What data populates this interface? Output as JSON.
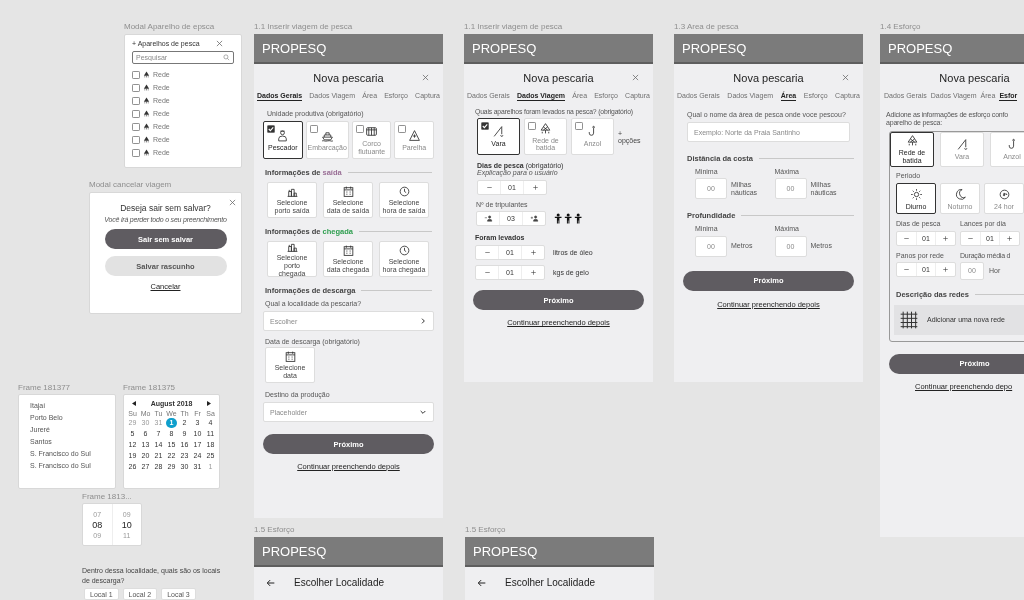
{
  "modal_gear_picker": {
    "frame_label": "Modal Aparelho de epsca",
    "title": "+ Aparelhos de pesca",
    "search": {
      "placeholder": "Pesquisar"
    },
    "items": [
      {
        "label": "Rede",
        "checked": false
      },
      {
        "label": "Rede",
        "checked": false
      },
      {
        "label": "Rede",
        "checked": false
      },
      {
        "label": "Rede",
        "checked": false
      },
      {
        "label": "Rede",
        "checked": false
      },
      {
        "label": "Rede",
        "checked": false
      },
      {
        "label": "Rede",
        "checked": false
      }
    ]
  },
  "modal_cancel": {
    "frame_label": "Modal cancelar viagem",
    "title": "Deseja sair sem salvar?",
    "subtitle": "Você irá perder todo o seu preenchimento",
    "buttons": [
      {
        "label": "Sair sem salvar",
        "kind": "primary"
      },
      {
        "label": "Salvar rascunho",
        "kind": "secondary"
      },
      {
        "label": "Cancelar",
        "kind": "link"
      }
    ]
  },
  "locality_list": {
    "frame_label": "Frame 181377",
    "items": [
      "Itajaí",
      "Porto Belo",
      "Jureré",
      "Santos",
      "S. Francisco do Sul",
      "S. Francisco do Sul"
    ]
  },
  "calendar": {
    "frame_label": "Frame 181375",
    "month": "August 2018",
    "weekdays": [
      "Su",
      "Mo",
      "Tu",
      "We",
      "Th",
      "Fr",
      "Sa"
    ],
    "days": [
      {
        "text": "29",
        "muted": true,
        "selected": false
      },
      {
        "text": "30",
        "muted": true,
        "selected": false
      },
      {
        "text": "31",
        "muted": true,
        "selected": false
      },
      {
        "text": "1",
        "muted": false,
        "selected": true
      },
      {
        "text": "2",
        "muted": false,
        "selected": false
      },
      {
        "text": "3",
        "muted": false,
        "selected": false
      },
      {
        "text": "4",
        "muted": false,
        "selected": false
      },
      {
        "text": "5",
        "muted": false,
        "selected": false
      },
      {
        "text": "6",
        "muted": false,
        "selected": false
      },
      {
        "text": "7",
        "muted": false,
        "selected": false
      },
      {
        "text": "8",
        "muted": false,
        "selected": false
      },
      {
        "text": "9",
        "muted": false,
        "selected": false
      },
      {
        "text": "10",
        "muted": false,
        "selected": false
      },
      {
        "text": "11",
        "muted": false,
        "selected": false
      },
      {
        "text": "12",
        "muted": false,
        "selected": false
      },
      {
        "text": "13",
        "muted": false,
        "selected": false
      },
      {
        "text": "14",
        "muted": false,
        "selected": false
      },
      {
        "text": "15",
        "muted": false,
        "selected": false
      },
      {
        "text": "16",
        "muted": false,
        "selected": false
      },
      {
        "text": "17",
        "muted": false,
        "selected": false
      },
      {
        "text": "18",
        "muted": false,
        "selected": false
      },
      {
        "text": "19",
        "muted": false,
        "selected": false
      },
      {
        "text": "20",
        "muted": false,
        "selected": false
      },
      {
        "text": "21",
        "muted": false,
        "selected": false
      },
      {
        "text": "22",
        "muted": false,
        "selected": false
      },
      {
        "text": "23",
        "muted": false,
        "selected": false
      },
      {
        "text": "24",
        "muted": false,
        "selected": false
      },
      {
        "text": "25",
        "muted": false,
        "selected": false
      },
      {
        "text": "26",
        "muted": false,
        "selected": false
      },
      {
        "text": "27",
        "muted": false,
        "selected": false
      },
      {
        "text": "28",
        "muted": false,
        "selected": false
      },
      {
        "text": "29",
        "muted": false,
        "selected": false
      },
      {
        "text": "30",
        "muted": false,
        "selected": false
      },
      {
        "text": "31",
        "muted": false,
        "selected": false
      },
      {
        "text": "1",
        "muted": true,
        "selected": false
      }
    ]
  },
  "time_picker": {
    "frame_label": "Frame 1813...",
    "columns": [
      {
        "above": "07",
        "value": "08",
        "below": "09"
      },
      {
        "above": "09",
        "value": "10",
        "below": "11"
      }
    ]
  },
  "unload_places": {
    "question": "Dentro dessa localidade, quais são os locais de descarga?",
    "options": [
      "Local 1",
      "Local 2",
      "Local 3"
    ]
  },
  "screen_general": {
    "frame_label": "1.1 Inserir viagem de pesca",
    "app_title": "PROPESQ",
    "heading": "Nova pescaria",
    "tabs": [
      {
        "label": "Dados Gerais",
        "selected": true
      },
      {
        "label": "Dados Viagem",
        "selected": false
      },
      {
        "label": "Área",
        "selected": false
      },
      {
        "label": "Esforço",
        "selected": false
      },
      {
        "label": "Captura",
        "selected": false
      }
    ],
    "unit_label": "Unidade produtiva (obrigatório)",
    "units": [
      {
        "label": "Pescador",
        "checked": true
      },
      {
        "label": "Embarcação",
        "checked": false
      },
      {
        "label": "Corco flutuante",
        "checked": false
      },
      {
        "label": "Parelha",
        "checked": false
      }
    ],
    "info_sections": [
      {
        "title": "Informações de",
        "highlight": "saída",
        "color": "#9a6f96",
        "tiles": [
          "Selecione porto saída",
          "Selecione data de saída",
          "Selecione hora de saída"
        ]
      },
      {
        "title": "Informações de",
        "highlight": "chegada",
        "color": "#2e9e4f",
        "tiles": [
          "Selecione porto chegada",
          "Selecione data chegada",
          "Selecione hora chegada"
        ]
      }
    ],
    "unload": {
      "title": "Informações de descarga",
      "place_label": "Qual a localidade da pescaria?",
      "place_field": {
        "placeholder": "Escolher"
      },
      "date_label": "Data de descarga (obrigatório)",
      "date_button": "Selecione data",
      "dest_label": "Destino da produção",
      "dest_select": {
        "placeholder": "Placeholder"
      }
    },
    "next": "Próximo",
    "later": "Continuar preenchendo depois"
  },
  "screen_trip": {
    "frame_label": "1.1 Inserir viagem de pesca",
    "app_title": "PROPESQ",
    "heading": "Nova pescaria",
    "tabs": [
      {
        "label": "Dados Gerais",
        "selected": false
      },
      {
        "label": "Dados Viagem",
        "selected": true
      },
      {
        "label": "Área",
        "selected": false
      },
      {
        "label": "Esforço",
        "selected": false
      },
      {
        "label": "Captura",
        "selected": false
      }
    ],
    "gear_label": "Quais aparelhos foram levados na pesca? (obrigatório)",
    "gears": [
      {
        "label": "Vara",
        "checked": true
      },
      {
        "label": "Rede de batida",
        "checked": false
      },
      {
        "label": "Anzol",
        "checked": false
      }
    ],
    "more": "+ opções",
    "days": {
      "label": "**Dias de pesca** (obrigatório)",
      "help": "Explicação para o usuário",
      "value": "01"
    },
    "crew": {
      "label": "Nº de tripulantes",
      "value": "03"
    },
    "taken_label": "Foram levados",
    "taken": [
      {
        "value": "01",
        "unit": "litros de óleo"
      },
      {
        "value": "01",
        "unit": "kgs de gelo"
      }
    ],
    "next": "Próximo",
    "later": "Continuar preenchendo depois"
  },
  "screen_area": {
    "frame_label": "1.3 Area de pesca",
    "app_title": "PROPESQ",
    "heading": "Nova pescaria",
    "tabs": [
      {
        "label": "Dados Gerais",
        "selected": false
      },
      {
        "label": "Dados Viagem",
        "selected": false
      },
      {
        "label": "Área",
        "selected": true
      },
      {
        "label": "Esforço",
        "selected": false
      },
      {
        "label": "Captura",
        "selected": false
      }
    ],
    "question": "Qual o nome da área de pesca onde voce pescou?",
    "name_field": {
      "placeholder": "Exemplo: Norte da Praia Santinho"
    },
    "groups": [
      {
        "title": "Distância da costa",
        "fields": [
          {
            "label": "Minima",
            "placeholder": "00",
            "unit": "Milhas náuticas"
          },
          {
            "label": "Máxima",
            "placeholder": "00",
            "unit": "Milhas náuticas"
          }
        ]
      },
      {
        "title": "Profundidade",
        "fields": [
          {
            "label": "Minima",
            "placeholder": "00",
            "unit": "Metros"
          },
          {
            "label": "Máxima",
            "placeholder": "00",
            "unit": "Metros"
          }
        ]
      }
    ],
    "next": "Próximo",
    "later": "Continuar preenchendo depois"
  },
  "screen_effort": {
    "frame_label": "1.4 Esforço",
    "app_title": "PROPESQ",
    "heading": "Nova pescaria",
    "tabs": [
      {
        "label": "Dados Gerais",
        "selected": false
      },
      {
        "label": "Dados Viagem",
        "selected": false
      },
      {
        "label": "Área",
        "selected": false
      },
      {
        "label": "Esfor",
        "selected": true
      }
    ],
    "intro_lines": [
      "Adicione as informações de esforço confo",
      "aparelho de pesca:"
    ],
    "gear_tabs": [
      {
        "label": "Rede de batida",
        "selected": true
      },
      {
        "label": "Vara",
        "selected": false
      },
      {
        "label": "Anzol",
        "selected": false
      }
    ],
    "period_label": "Periodo",
    "periods": [
      {
        "label": "Diurno",
        "selected": true
      },
      {
        "label": "Noturno",
        "selected": false
      },
      {
        "label": "24 hor",
        "selected": false
      }
    ],
    "steppers": [
      {
        "label": "Dias de pesca",
        "value": "01"
      },
      {
        "label": "Lances por dia",
        "value": "01"
      },
      {
        "label": "Panos por rede",
        "value": "01"
      }
    ],
    "duration": {
      "label": "Duração média d",
      "placeholder": "00",
      "unit": "Hor"
    },
    "nets_title": "Descrição das redes",
    "add_net": "Adicionar uma nova rede",
    "next": "Próximo",
    "later": "Continuar preenchendo depo"
  },
  "screens_locality": [
    {
      "frame_label": "1.5 Esforço",
      "app_title": "PROPESQ",
      "title": "Escolher Localidade"
    },
    {
      "frame_label": "1.5 Esforço",
      "app_title": "PROPESQ",
      "title": "Escolher Localidade"
    }
  ]
}
